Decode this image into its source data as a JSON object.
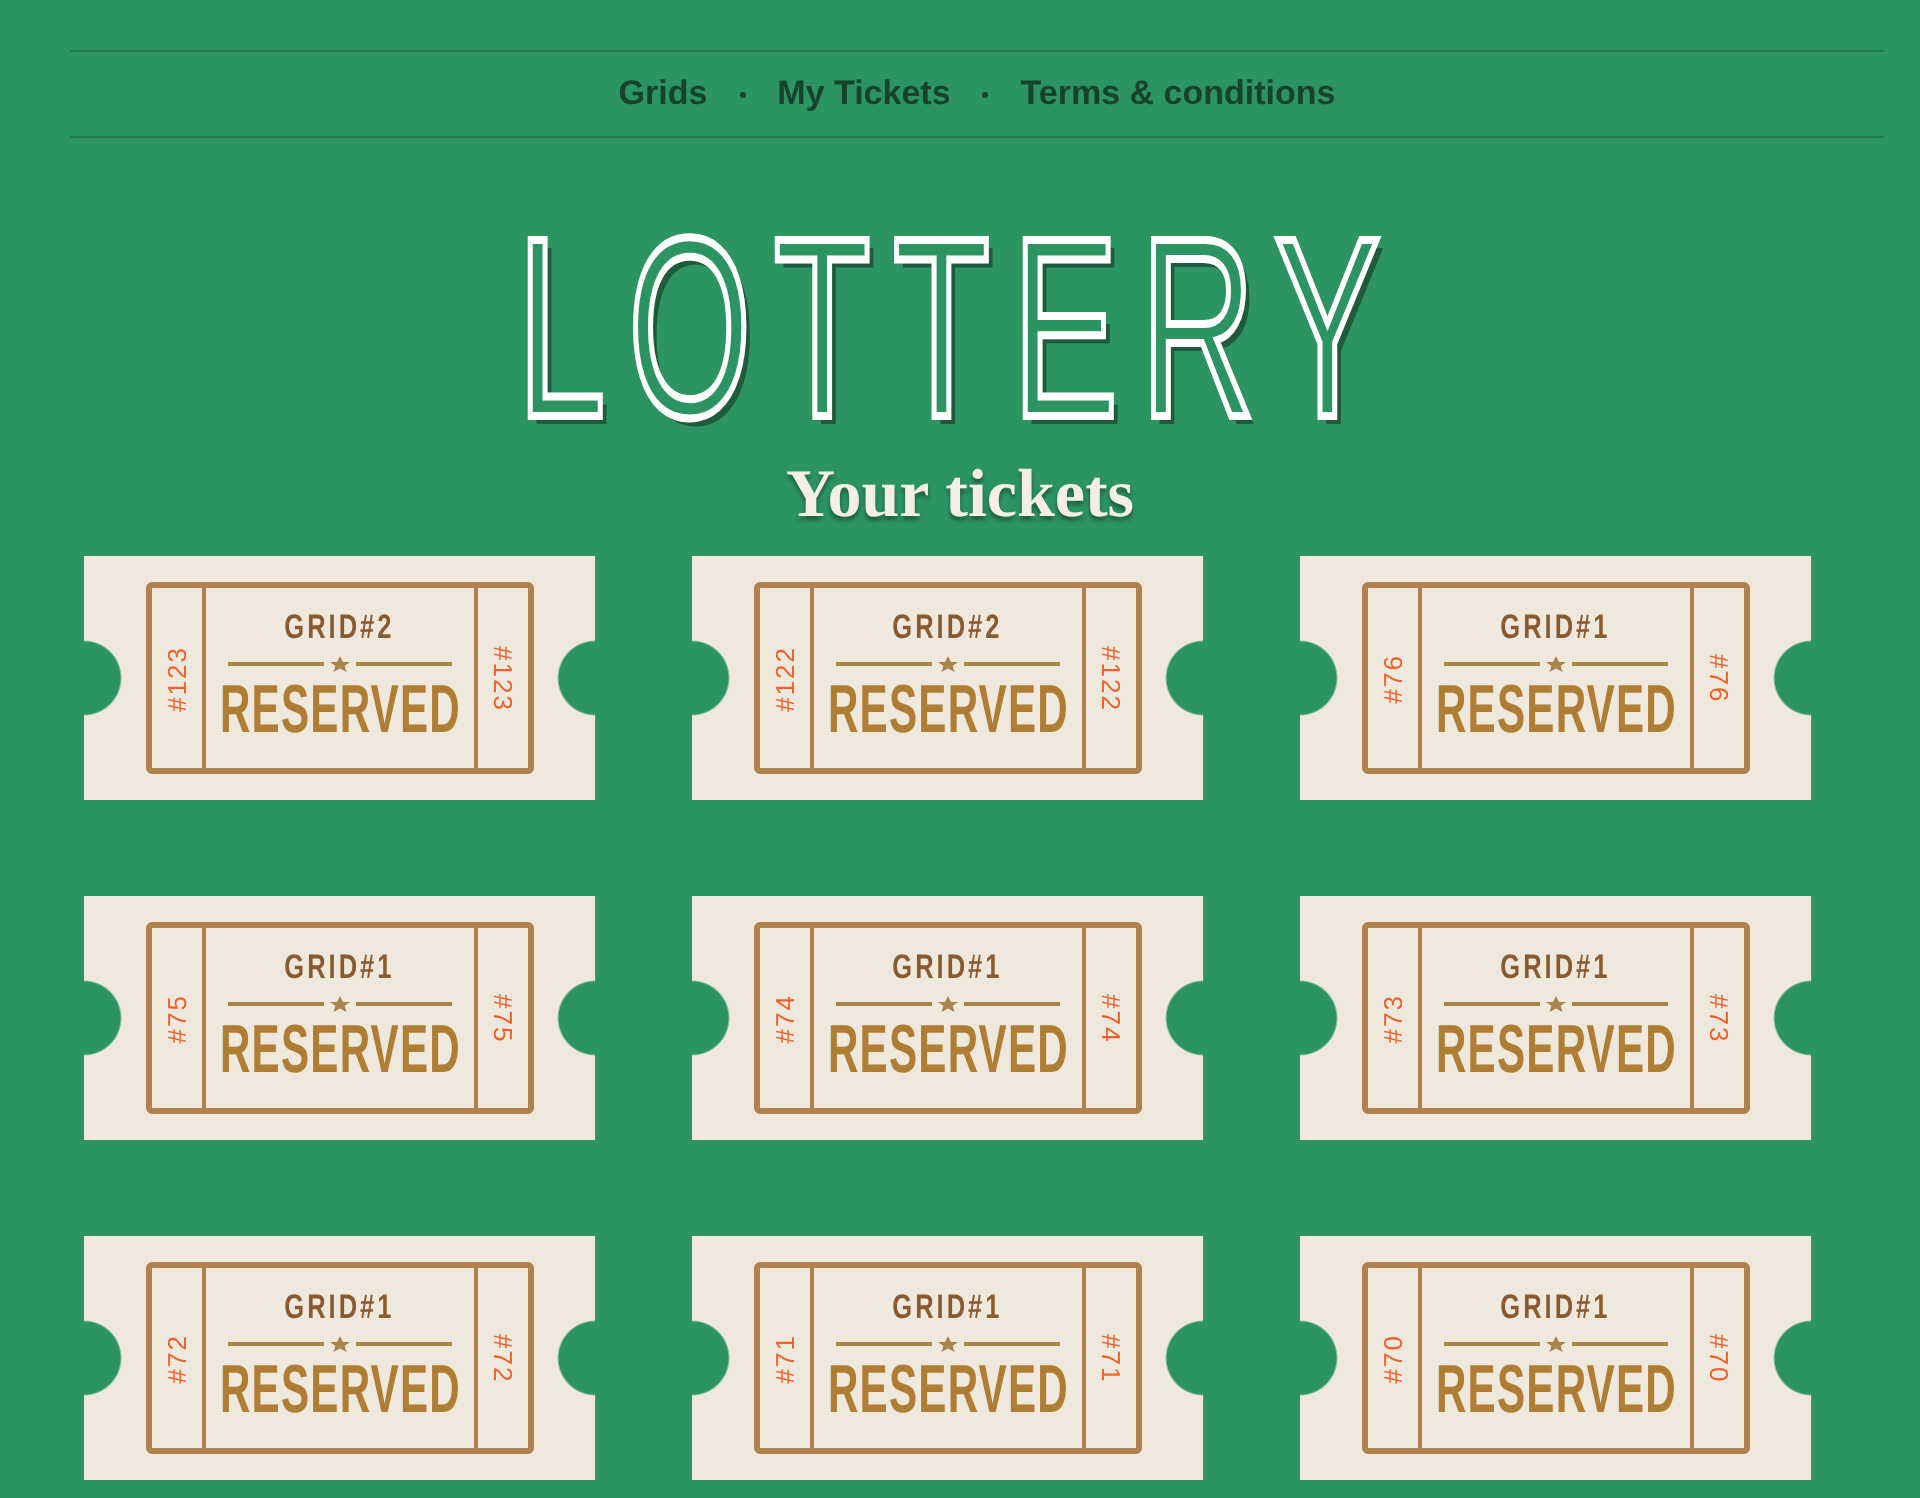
{
  "nav": {
    "links": [
      {
        "label": "Grids"
      },
      {
        "label": "My Tickets"
      },
      {
        "label": "Terms & conditions"
      }
    ]
  },
  "title": "LOTTERY",
  "heading": "Your tickets",
  "tickets": [
    {
      "grid": "GRID#2",
      "status": "RESERVED",
      "number_left": "#123",
      "number_right": "#123"
    },
    {
      "grid": "GRID#2",
      "status": "RESERVED",
      "number_left": "#122",
      "number_right": "#122"
    },
    {
      "grid": "GRID#1",
      "status": "RESERVED",
      "number_left": "#76",
      "number_right": "#76"
    },
    {
      "grid": "GRID#1",
      "status": "RESERVED",
      "number_left": "#75",
      "number_right": "#75"
    },
    {
      "grid": "GRID#1",
      "status": "RESERVED",
      "number_left": "#74",
      "number_right": "#74"
    },
    {
      "grid": "GRID#1",
      "status": "RESERVED",
      "number_left": "#73",
      "number_right": "#73"
    },
    {
      "grid": "GRID#1",
      "status": "RESERVED",
      "number_left": "#72",
      "number_right": "#72"
    },
    {
      "grid": "GRID#1",
      "status": "RESERVED",
      "number_left": "#71",
      "number_right": "#71"
    },
    {
      "grid": "GRID#1",
      "status": "RESERVED",
      "number_left": "#70",
      "number_right": "#70"
    }
  ]
}
